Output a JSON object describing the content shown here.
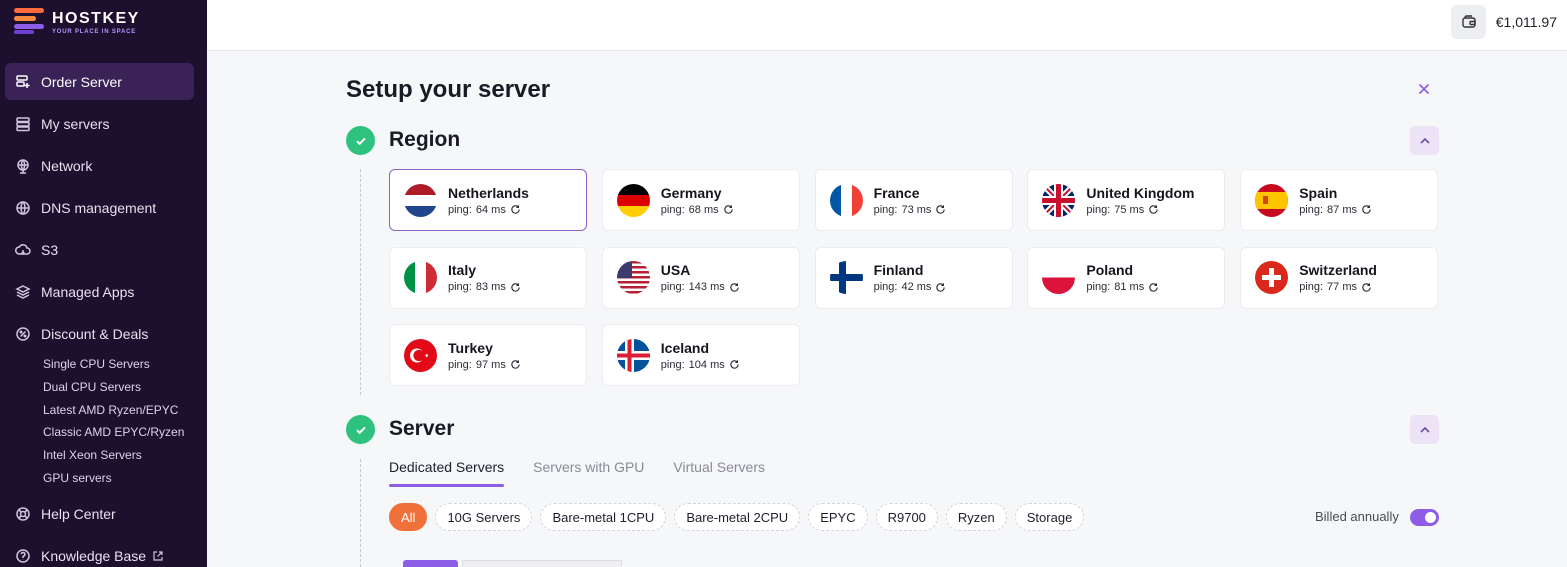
{
  "brand": {
    "name": "HOSTKEY",
    "tagline": "YOUR PLACE IN SPACE"
  },
  "sidebar": {
    "items": [
      {
        "label": "Order Server",
        "icon": "server-plus-icon",
        "active": true
      },
      {
        "label": "My servers",
        "icon": "servers-icon"
      },
      {
        "label": "Network",
        "icon": "network-icon"
      },
      {
        "label": "DNS management",
        "icon": "dns-icon"
      },
      {
        "label": "S3",
        "icon": "cloud-icon"
      },
      {
        "label": "Managed Apps",
        "icon": "layers-icon"
      },
      {
        "label": "Discount & Deals",
        "icon": "discount-icon"
      }
    ],
    "deals": [
      "Single CPU Servers",
      "Dual CPU Servers",
      "Latest AMD Ryzen/EPYC",
      "Classic AMD EPYC/Ryzen",
      "Intel Xeon Servers",
      "GPU servers"
    ],
    "help": "Help Center",
    "kb": "Knowledge Base"
  },
  "topbar": {
    "balance": "€1,011.97"
  },
  "page": {
    "title": "Setup your server"
  },
  "region": {
    "title": "Region",
    "ping_label": "ping:",
    "countries": [
      {
        "name": "Netherlands",
        "ping": "64 ms",
        "selected": true
      },
      {
        "name": "Germany",
        "ping": "68 ms"
      },
      {
        "name": "France",
        "ping": "73 ms"
      },
      {
        "name": "United Kingdom",
        "ping": "75 ms"
      },
      {
        "name": "Spain",
        "ping": "87 ms"
      },
      {
        "name": "Italy",
        "ping": "83 ms"
      },
      {
        "name": "USA",
        "ping": "143 ms"
      },
      {
        "name": "Finland",
        "ping": "42 ms"
      },
      {
        "name": "Poland",
        "ping": "81 ms"
      },
      {
        "name": "Switzerland",
        "ping": "77 ms"
      },
      {
        "name": "Turkey",
        "ping": "97 ms"
      },
      {
        "name": "Iceland",
        "ping": "104 ms"
      }
    ]
  },
  "server": {
    "title": "Server",
    "tabs": [
      "Dedicated Servers",
      "Servers with GPU",
      "Virtual Servers"
    ],
    "filters": [
      "All",
      "10G Servers",
      "Bare-metal 1CPU",
      "Bare-metal 2CPU",
      "EPYC",
      "R9700",
      "Ryzen",
      "Storage"
    ],
    "billed_label": "Billed annually",
    "billed_on": true
  },
  "colors": {
    "sidebar_bg": "#1d0f2e",
    "accent": "#8e5de8",
    "orange": "#f0703a",
    "success": "#2ec27e"
  }
}
